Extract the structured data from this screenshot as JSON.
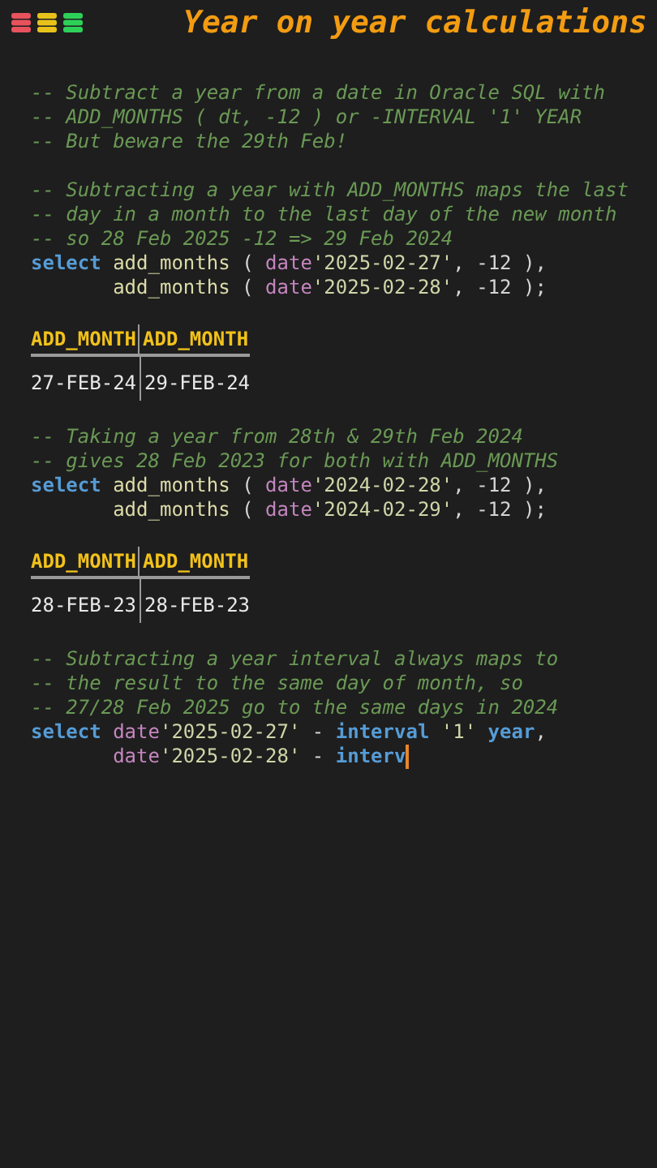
{
  "title": "Year on year calculations",
  "blocks": [
    {
      "kind": "code",
      "lines": [
        [
          {
            "kind": "comment",
            "text": "-- Subtract a year from a date in Oracle SQL with"
          }
        ],
        [
          {
            "kind": "comment",
            "text": "-- ADD_MONTHS ( dt, -12 ) or -INTERVAL '1' YEAR"
          }
        ],
        [
          {
            "kind": "comment",
            "text": "-- But beware the 29th Feb!"
          }
        ]
      ]
    },
    {
      "kind": "code",
      "lines": [
        [
          {
            "kind": "comment",
            "text": "-- Subtracting a year with ADD_MONTHS maps the last"
          }
        ],
        [
          {
            "kind": "comment",
            "text": "-- day in a month to the last day of the new month"
          }
        ],
        [
          {
            "kind": "comment",
            "text": "-- so 28 Feb 2025 -12 => 29 Feb 2024"
          }
        ],
        [
          {
            "kind": "keyword",
            "text": "select"
          },
          {
            "kind": "function",
            "text": " add_months"
          },
          {
            "kind": "plain",
            "text": " ( "
          },
          {
            "kind": "type",
            "text": "date"
          },
          {
            "kind": "string",
            "text": "'2025-02-27'"
          },
          {
            "kind": "plain",
            "text": ", -12 ),"
          }
        ],
        [
          {
            "kind": "function",
            "text": "       add_months"
          },
          {
            "kind": "plain",
            "text": " ( "
          },
          {
            "kind": "type",
            "text": "date"
          },
          {
            "kind": "string",
            "text": "'2025-02-28'"
          },
          {
            "kind": "plain",
            "text": ", -12 );"
          }
        ]
      ]
    },
    {
      "kind": "table",
      "columns": [
        "ADD_MONTH",
        "ADD_MONTH"
      ],
      "rows": [
        [
          "27-FEB-24",
          "29-FEB-24"
        ]
      ]
    },
    {
      "kind": "code",
      "lines": [
        [
          {
            "kind": "comment",
            "text": "-- Taking a year from 28th & 29th Feb 2024"
          }
        ],
        [
          {
            "kind": "comment",
            "text": "-- gives 28 Feb 2023 for both with ADD_MONTHS"
          }
        ],
        [
          {
            "kind": "keyword",
            "text": "select"
          },
          {
            "kind": "function",
            "text": " add_months"
          },
          {
            "kind": "plain",
            "text": " ( "
          },
          {
            "kind": "type",
            "text": "date"
          },
          {
            "kind": "string",
            "text": "'2024-02-28'"
          },
          {
            "kind": "plain",
            "text": ", -12 ),"
          }
        ],
        [
          {
            "kind": "function",
            "text": "       add_months"
          },
          {
            "kind": "plain",
            "text": " ( "
          },
          {
            "kind": "type",
            "text": "date"
          },
          {
            "kind": "string",
            "text": "'2024-02-29'"
          },
          {
            "kind": "plain",
            "text": ", -12 );"
          }
        ]
      ]
    },
    {
      "kind": "table",
      "columns": [
        "ADD_MONTH",
        "ADD_MONTH"
      ],
      "rows": [
        [
          "28-FEB-23",
          "28-FEB-23"
        ]
      ]
    },
    {
      "kind": "code",
      "cursor": true,
      "lines": [
        [
          {
            "kind": "comment",
            "text": "-- Subtracting a year interval always maps to"
          }
        ],
        [
          {
            "kind": "comment",
            "text": "-- the result to the same day of month, so"
          }
        ],
        [
          {
            "kind": "comment",
            "text": "-- 27/28 Feb 2025 go to the same days in 2024"
          }
        ],
        [
          {
            "kind": "keyword",
            "text": "select"
          },
          {
            "kind": "type",
            "text": " date"
          },
          {
            "kind": "string",
            "text": "'2025-02-27'"
          },
          {
            "kind": "plain",
            "text": " - "
          },
          {
            "kind": "keyword",
            "text": "interval"
          },
          {
            "kind": "string",
            "text": " '1'"
          },
          {
            "kind": "keyword",
            "text": " year"
          },
          {
            "kind": "plain",
            "text": ","
          }
        ],
        [
          {
            "kind": "type",
            "text": "       date"
          },
          {
            "kind": "string",
            "text": "'2025-02-28'"
          },
          {
            "kind": "plain",
            "text": " - "
          },
          {
            "kind": "keyword",
            "text": "interv"
          }
        ]
      ]
    }
  ]
}
